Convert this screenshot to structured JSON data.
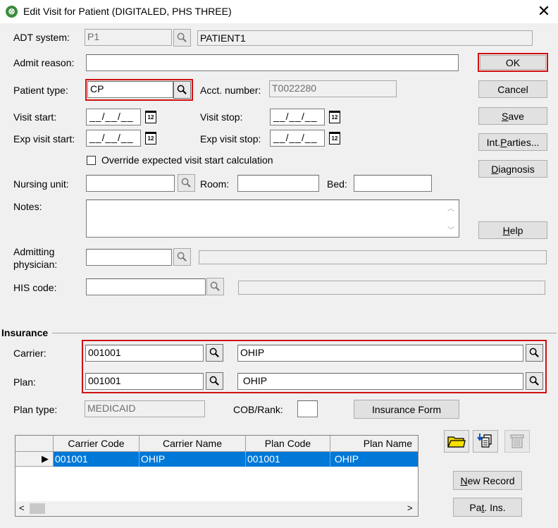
{
  "window": {
    "title": "Edit Visit for Patient (DIGITALED, PHS THREE)",
    "close_glyph": "✕"
  },
  "adt": {
    "label": "ADT system:",
    "code": "P1",
    "name": "PATIENT1"
  },
  "admit_reason": {
    "label": "Admit reason:",
    "value": ""
  },
  "patient_type": {
    "label": "Patient type:",
    "value": "CP"
  },
  "acct": {
    "label": "Acct. number:",
    "value": "T0022280"
  },
  "visit_start": {
    "label": "Visit start:",
    "value": "__/__/__"
  },
  "visit_stop": {
    "label": "Visit stop:",
    "value": "__/__/__"
  },
  "exp_visit_start": {
    "label": "Exp visit start:",
    "value": "__/__/__"
  },
  "exp_visit_stop": {
    "label": "Exp visit stop:",
    "value": "__/__/__"
  },
  "calendar_glyph": "12",
  "override": {
    "label": "Override expected visit start calculation",
    "checked": false
  },
  "nursing_unit": {
    "label": "Nursing unit:",
    "value": ""
  },
  "room": {
    "label": "Room:",
    "value": ""
  },
  "bed": {
    "label": "Bed:",
    "value": ""
  },
  "notes": {
    "label": "Notes:",
    "value": ""
  },
  "admitting_physician": {
    "label_line1": "Admitting",
    "label_line2": "physician:",
    "value": ""
  },
  "his_code": {
    "label": "HIS code:",
    "value": ""
  },
  "buttons": {
    "ok": "OK",
    "cancel": "Cancel",
    "save_prefix": "",
    "save_ul": "S",
    "save_rest": "ave",
    "int_prefix": "Int. ",
    "int_ul": "P",
    "int_rest": "arties...",
    "diag_prefix": "",
    "diag_ul": "D",
    "diag_rest": "iagnosis",
    "help_prefix": "",
    "help_ul": "H",
    "help_rest": "elp",
    "insurance_form": "Insurance Form",
    "new_prefix": "",
    "new_ul": "N",
    "new_rest": "ew Record",
    "pat_prefix": "Pa",
    "pat_ul": "t",
    "pat_rest": ". Ins."
  },
  "insurance": {
    "section_title": "Insurance",
    "carrier": {
      "label": "Carrier:",
      "code": "001001",
      "name": "OHIP"
    },
    "plan": {
      "label": "Plan:",
      "code": "001001",
      "name": " OHIP"
    },
    "plan_type": {
      "label": "Plan type:",
      "value": "MEDICAID"
    },
    "cob": {
      "label": "COB/Rank:",
      "value": ""
    }
  },
  "grid": {
    "columns": [
      "Carrier Code",
      "Carrier Name",
      "Plan Code",
      "Plan Name"
    ],
    "rows": [
      {
        "carrier_code": "001001",
        "carrier_name": "OHIP",
        "plan_code": "001001",
        "plan_name": " OHIP"
      }
    ],
    "row_pointer": "▶",
    "scroll_left": "<",
    "scroll_right": ">"
  },
  "icons": {
    "title": "app-logo-icon",
    "search": "magnifier-icon",
    "calendar": "calendar-icon",
    "folder": "folder-open-icon",
    "import": "import-records-icon",
    "delete": "delete-records-icon"
  },
  "colors": {
    "highlight_red": "#d01010",
    "selection_blue": "#0078d7",
    "folder_yellow": "#f0d400"
  }
}
